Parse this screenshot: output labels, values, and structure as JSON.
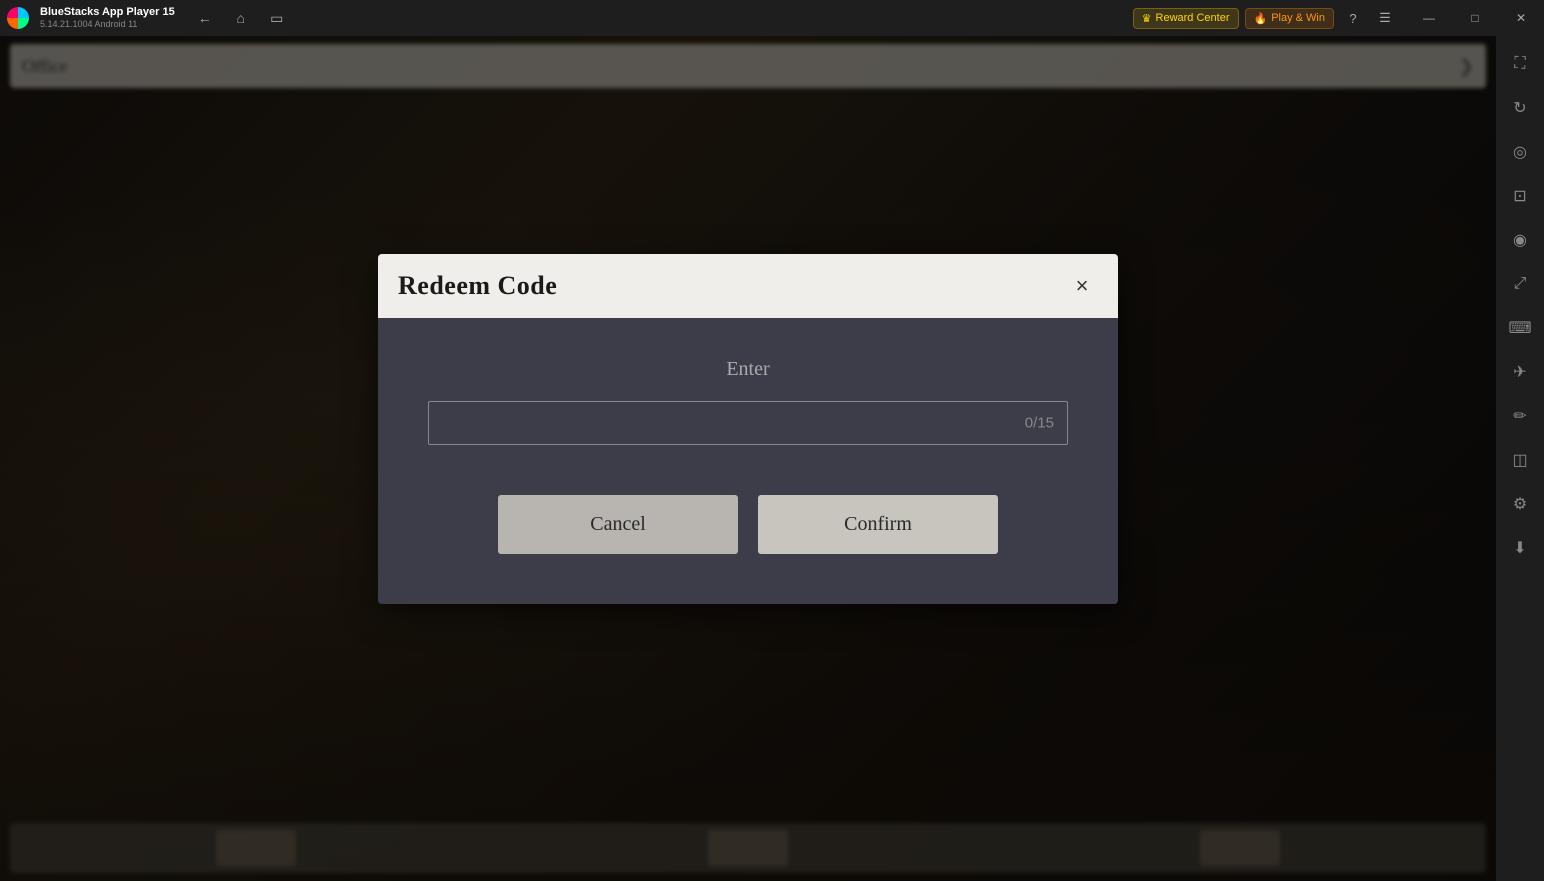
{
  "titlebar": {
    "app_name": "BlueStacks App Player 15",
    "app_version": "5.14.21.1004  Android 11",
    "reward_center_label": "Reward Center",
    "play_win_label": "Play & Win"
  },
  "dialog": {
    "title": "Redeem Code",
    "close_button_label": "×",
    "enter_label": "Enter",
    "input_placeholder": "",
    "input_counter": "0/15",
    "cancel_label": "Cancel",
    "confirm_label": "Confirm"
  },
  "sidebar": {
    "icons": [
      {
        "name": "sidebar-top-icon",
        "symbol": "⛶"
      },
      {
        "name": "sidebar-rotate-icon",
        "symbol": "↻"
      },
      {
        "name": "sidebar-volume-icon",
        "symbol": "◎"
      },
      {
        "name": "sidebar-screenshot-icon",
        "symbol": "⊡"
      },
      {
        "name": "sidebar-camera-icon",
        "symbol": "◉"
      },
      {
        "name": "sidebar-resize-icon",
        "symbol": "⤢"
      },
      {
        "name": "sidebar-keyboard-icon",
        "symbol": "⌨"
      },
      {
        "name": "sidebar-gamepad-icon",
        "symbol": "✈"
      },
      {
        "name": "sidebar-pen-icon",
        "symbol": "✏"
      },
      {
        "name": "sidebar-eraser-icon",
        "symbol": "◫"
      },
      {
        "name": "sidebar-settings-icon",
        "symbol": "⚙"
      },
      {
        "name": "sidebar-download-icon",
        "symbol": "⬇"
      }
    ]
  },
  "colors": {
    "titlebar_bg": "#1e1e1e",
    "dialog_header_bg": "#f0eeea",
    "dialog_body_bg": "#3d3d4a",
    "cancel_btn_bg": "#b8b5b0",
    "confirm_btn_bg": "#c8c5be"
  }
}
